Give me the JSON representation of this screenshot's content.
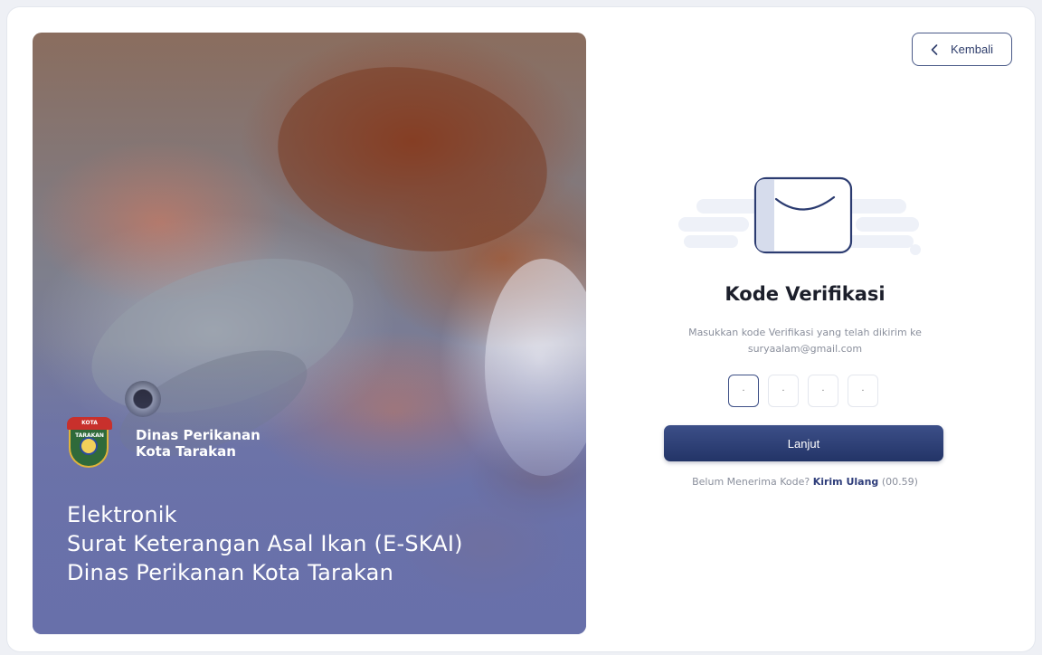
{
  "back_button": {
    "label": "Kembali",
    "icon": "chevron-left-icon"
  },
  "hero": {
    "image_subject": "seafood-photo",
    "brand": {
      "crest_text": "KOTA TARAKAN",
      "line1": "Dinas Perikanan",
      "line2": "Kota Tarakan"
    },
    "title_lines": [
      "Elektronik",
      "Surat Keterangan Asal Ikan (E-SKAI)",
      "Dinas Perikanan Kota Tarakan"
    ]
  },
  "verification": {
    "illustration_icon": "envelope-icon",
    "title": "Kode Verifikasi",
    "description_line1": "Masukkan kode Verifikasi yang telah dikirim ke",
    "email": "suryaalam@gmail.com",
    "otp_placeholders": [
      "·",
      "·",
      "·",
      "·"
    ],
    "submit_label": "Lanjut",
    "resend_prompt": "Belum Menerima Kode?",
    "resend_link": "Kirim Ulang",
    "resend_timer": "(00.59)"
  },
  "colors": {
    "primary": "#2b3b70",
    "hero_overlay": "#6870aa",
    "muted_text": "#8a8f9c"
  }
}
